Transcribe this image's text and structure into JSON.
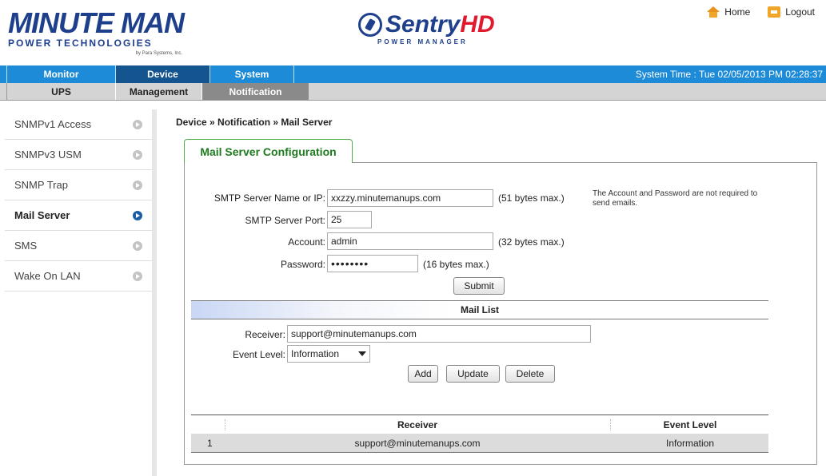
{
  "header": {
    "logo_main": "MINUTE MAN",
    "logo_sub": "POWER TECHNOLOGIES",
    "logo_tiny": "by Para Systems, Inc.",
    "product_main": "Sentry",
    "product_hd": "HD",
    "product_sub": "POWER MANAGER",
    "home_label": "Home",
    "logout_label": "Logout"
  },
  "nav": {
    "main": [
      "Monitor",
      "Device",
      "System"
    ],
    "active_main": "Device",
    "system_time": "System Time : Tue 02/05/2013 PM 02:28:37",
    "sub": [
      "UPS",
      "Management",
      "Notification"
    ],
    "active_sub": "Notification"
  },
  "sidebar": {
    "items": [
      {
        "label": "SNMPv1 Access"
      },
      {
        "label": "SNMPv3 USM"
      },
      {
        "label": "SNMP Trap"
      },
      {
        "label": "Mail Server"
      },
      {
        "label": "SMS"
      },
      {
        "label": "Wake On LAN"
      }
    ],
    "active": "Mail Server"
  },
  "breadcrumb": "Device » Notification » Mail Server",
  "tab_title": "Mail Server Configuration",
  "form": {
    "smtp_server_label": "SMTP Server Name or IP:",
    "smtp_server_value": "xxzzy.minutemanups.com",
    "smtp_server_hint": "(51 bytes max.)",
    "smtp_port_label": "SMTP Server Port:",
    "smtp_port_value": "25",
    "account_label": "Account:",
    "account_value": "admin",
    "account_hint": "(32 bytes max.)",
    "password_label": "Password:",
    "password_value": "••••••••",
    "password_hint": "(16 bytes max.)",
    "note": "The Account and Password are not required to send emails.",
    "submit_label": "Submit"
  },
  "mail_list": {
    "title": "Mail List",
    "receiver_label": "Receiver:",
    "receiver_value": "support@minutemanups.com",
    "event_level_label": "Event Level:",
    "event_level_value": "Information",
    "add_label": "Add",
    "update_label": "Update",
    "delete_label": "Delete",
    "columns": [
      "Receiver",
      "Event Level"
    ],
    "rows": [
      {
        "index": "1",
        "receiver": "support@minutemanups.com",
        "event_level": "Information"
      }
    ]
  }
}
